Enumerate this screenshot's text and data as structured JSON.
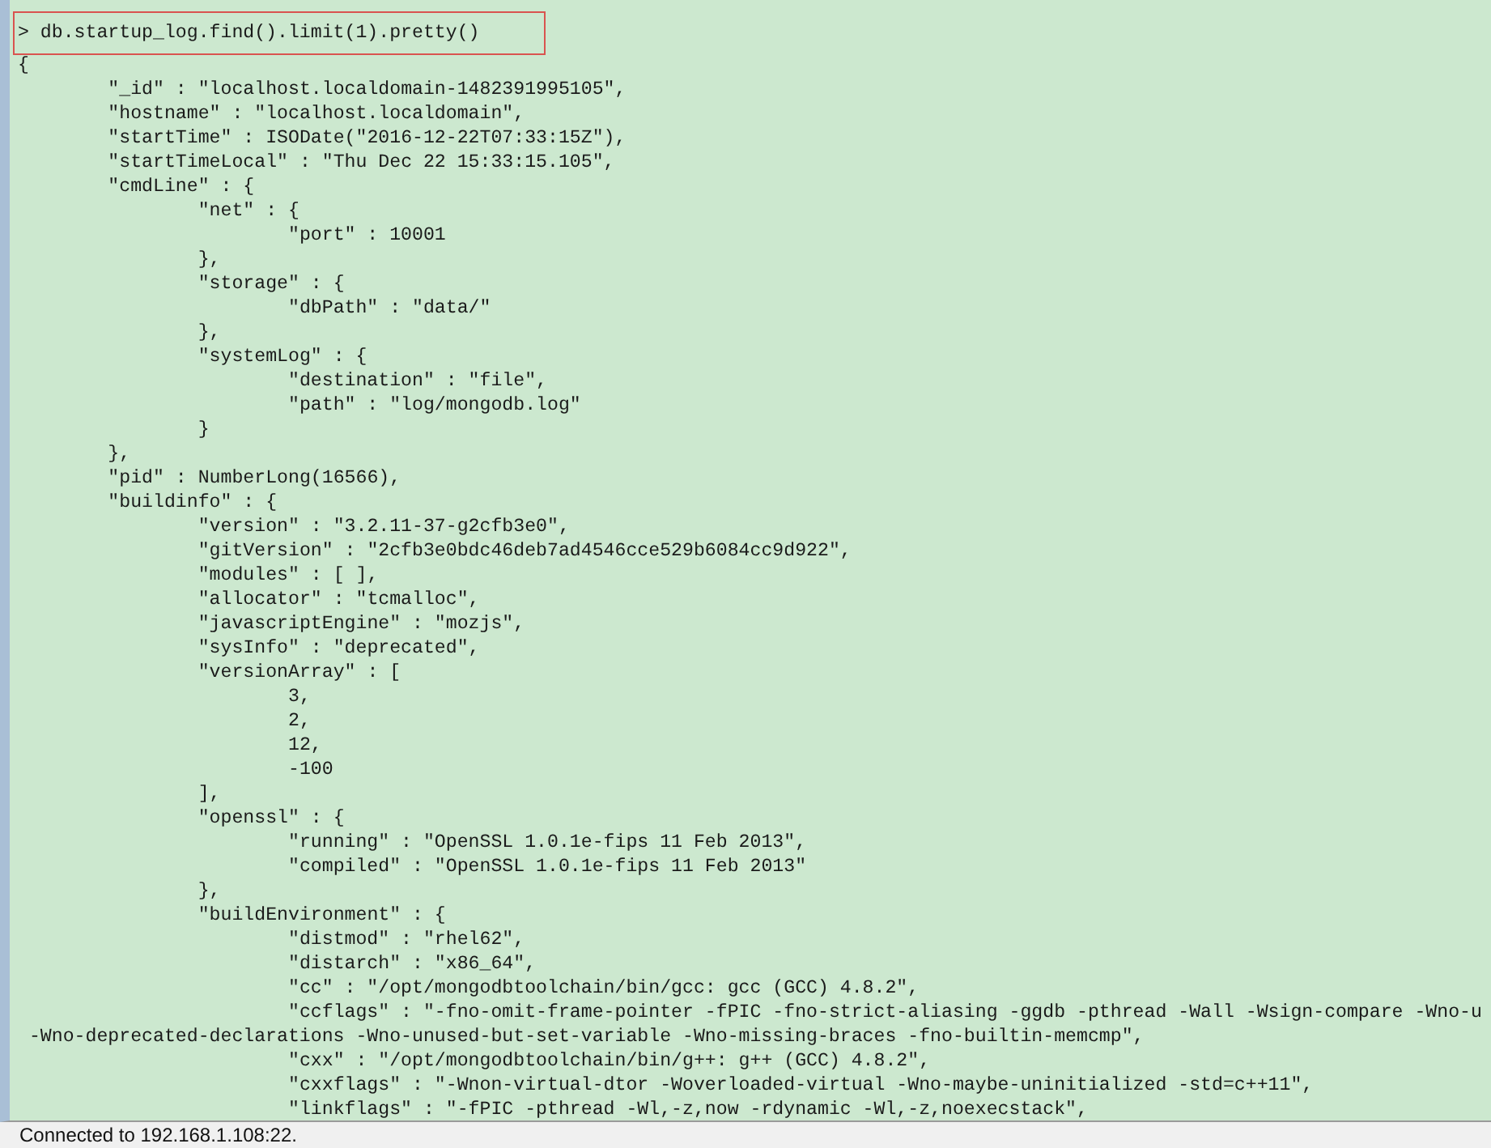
{
  "terminal": {
    "command": {
      "text": "> db.startup_log.find().limit(1).pretty()",
      "highlighted": true
    },
    "output_lines": [
      "{",
      "\t\"_id\" : \"localhost.localdomain-1482391995105\",",
      "\t\"hostname\" : \"localhost.localdomain\",",
      "\t\"startTime\" : ISODate(\"2016-12-22T07:33:15Z\"),",
      "\t\"startTimeLocal\" : \"Thu Dec 22 15:33:15.105\",",
      "\t\"cmdLine\" : {",
      "\t\t\"net\" : {",
      "\t\t\t\"port\" : 10001",
      "\t\t},",
      "\t\t\"storage\" : {",
      "\t\t\t\"dbPath\" : \"data/\"",
      "\t\t},",
      "\t\t\"systemLog\" : {",
      "\t\t\t\"destination\" : \"file\",",
      "\t\t\t\"path\" : \"log/mongodb.log\"",
      "\t\t}",
      "\t},",
      "\t\"pid\" : NumberLong(16566),",
      "\t\"buildinfo\" : {",
      "\t\t\"version\" : \"3.2.11-37-g2cfb3e0\",",
      "\t\t\"gitVersion\" : \"2cfb3e0bdc46deb7ad4546cce529b6084cc9d922\",",
      "\t\t\"modules\" : [ ],",
      "\t\t\"allocator\" : \"tcmalloc\",",
      "\t\t\"javascriptEngine\" : \"mozjs\",",
      "\t\t\"sysInfo\" : \"deprecated\",",
      "\t\t\"versionArray\" : [",
      "\t\t\t3,",
      "\t\t\t2,",
      "\t\t\t12,",
      "\t\t\t-100",
      "\t\t],",
      "\t\t\"openssl\" : {",
      "\t\t\t\"running\" : \"OpenSSL 1.0.1e-fips 11 Feb 2013\",",
      "\t\t\t\"compiled\" : \"OpenSSL 1.0.1e-fips 11 Feb 2013\"",
      "\t\t},",
      "\t\t\"buildEnvironment\" : {",
      "\t\t\t\"distmod\" : \"rhel62\",",
      "\t\t\t\"distarch\" : \"x86_64\",",
      "\t\t\t\"cc\" : \"/opt/mongodbtoolchain/bin/gcc: gcc (GCC) 4.8.2\",",
      "\t\t\t\"ccflags\" : \"-fno-omit-frame-pointer -fPIC -fno-strict-aliasing -ggdb -pthread -Wall -Wsign-compare -Wno-u",
      " -Wno-deprecated-declarations -Wno-unused-but-set-variable -Wno-missing-braces -fno-builtin-memcmp\",",
      "\t\t\t\"cxx\" : \"/opt/mongodbtoolchain/bin/g++: g++ (GCC) 4.8.2\",",
      "\t\t\t\"cxxflags\" : \"-Wnon-virtual-dtor -Woverloaded-virtual -Wno-maybe-uninitialized -std=c++11\",",
      "\t\t\t\"linkflags\" : \"-fPIC -pthread -Wl,-z,now -rdynamic -Wl,-z,noexecstack\","
    ]
  },
  "status_bar": {
    "text": "Connected to 192.168.1.108:22."
  }
}
